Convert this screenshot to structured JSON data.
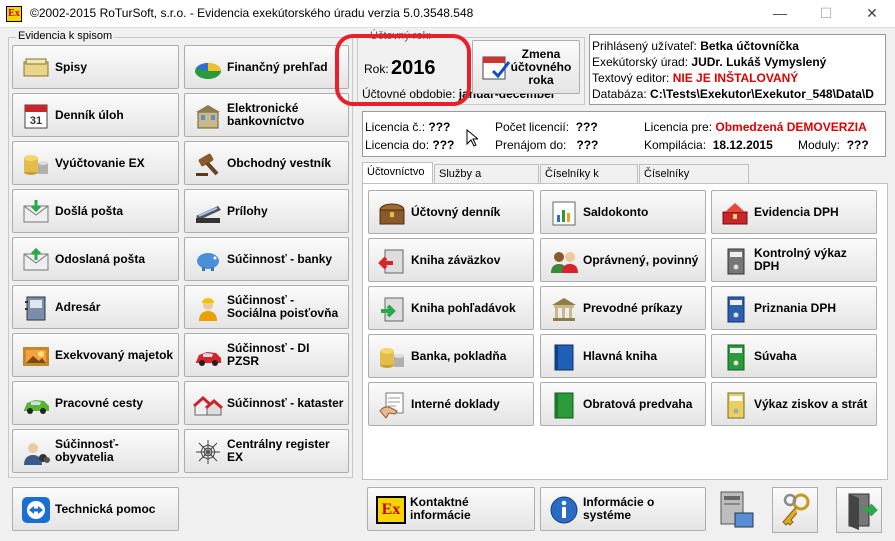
{
  "window": {
    "title": "©2002-2015 RoTurSoft, s.r.o. - Evidencia exekútorského úradu verzia 5.0.3548.548",
    "app_icon": "Ex"
  },
  "left_group": {
    "label": "Evidencia k spisom",
    "buttons": [
      {
        "label": "Spisy",
        "icon": "folder-stack-icon"
      },
      {
        "label": "Finančný prehľad",
        "icon": "pie-chart-icon"
      },
      {
        "label": "Denník úloh",
        "icon": "calendar-icon"
      },
      {
        "label": "Elektronické bankovníctvo",
        "icon": "bank-building-icon"
      },
      {
        "label": "Vyúčtovanie EX",
        "icon": "coins-icon"
      },
      {
        "label": "Obchodný vestník",
        "icon": "gavel-icon"
      },
      {
        "label": "Došlá pošta",
        "icon": "incoming-mail-icon"
      },
      {
        "label": "Prílohy",
        "icon": "scanner-icon"
      },
      {
        "label": "Odoslaná pošta",
        "icon": "outgoing-mail-icon"
      },
      {
        "label": "Súčinnosť - banky",
        "icon": "piggy-bank-icon"
      },
      {
        "label": "Adresár",
        "icon": "address-book-icon"
      },
      {
        "label": "Súčinnosť - Sociálna poisťovňa",
        "icon": "worker-icon"
      },
      {
        "label": "Exekvovaný majetok",
        "icon": "painting-icon"
      },
      {
        "label": "Súčinnosť - DI PZSR",
        "icon": "red-car-icon"
      },
      {
        "label": "Pracovné cesty",
        "icon": "green-car-icon"
      },
      {
        "label": "Súčinnosť - kataster",
        "icon": "houses-icon"
      },
      {
        "label": "Súčinnosť- obyvatelia",
        "icon": "people-icon"
      },
      {
        "label": "Centrálny register EX",
        "icon": "spider-web-icon"
      }
    ]
  },
  "year": {
    "group_label": "Účtovný rok:",
    "label": "Rok:",
    "value": "2016",
    "period_label": "Účtovné obdobie:",
    "period_value": "január-december",
    "change_button": "Zmena účtovného roka"
  },
  "user_info": [
    {
      "label": "Prihlásený užívateľ:",
      "value": "Betka účtovníčka",
      "red": false
    },
    {
      "label": "Exekútorský úrad:",
      "value": "JUDr. Lukáš Vymyslený",
      "red": false
    },
    {
      "label": "Textový editor:",
      "value": "NIE JE INŠTALOVANÝ",
      "red": true
    },
    {
      "label": "Databáza:",
      "value": "C:\\Tests\\Exekutor\\Exekutor_548\\Data\\D",
      "red": false
    }
  ],
  "license": {
    "number_label": "Licencia č.:",
    "number_value": "???",
    "count_label": "Počet licencií:",
    "count_value": "???",
    "for_label": "Licencia pre:",
    "for_value": "Obmedzená DEMOVERZIA",
    "until_label": "Licencia do:",
    "until_value": "???",
    "login_label": "Prenájom do:",
    "login_value": "???",
    "compile_label": "Kompilácia:",
    "compile_value": "18.12.2015",
    "modules_label": "Moduly:",
    "modules_value": "???"
  },
  "tabs": [
    "Účtovníctvo",
    "Služby a nastavenia",
    "Číselníky k spisom",
    "Číselníky účtovníctva"
  ],
  "acc_buttons": [
    {
      "label": "Účtovný denník",
      "icon": "treasure-chest-icon"
    },
    {
      "label": "Saldokonto",
      "icon": "chart-report-icon"
    },
    {
      "label": "Evidencia DPH",
      "icon": "tax-chest-icon"
    },
    {
      "label": "Kniha záväzkov",
      "icon": "red-arrow-book-icon"
    },
    {
      "label": "Oprávnený, povinný",
      "icon": "two-persons-icon"
    },
    {
      "label": "Kontrolný výkaz DPH",
      "icon": "gray-binder-icon"
    },
    {
      "label": "Kniha pohľadávok",
      "icon": "green-arrow-book-icon"
    },
    {
      "label": "Prevodné príkazy",
      "icon": "bank-icon"
    },
    {
      "label": "Priznania DPH",
      "icon": "blue-binder-icon"
    },
    {
      "label": "Banka, pokladňa",
      "icon": "coins-icon"
    },
    {
      "label": "Hlavná kniha",
      "icon": "blue-book-icon"
    },
    {
      "label": "Súvaha",
      "icon": "green-binder-icon"
    },
    {
      "label": "Interné doklady",
      "icon": "hand-document-icon"
    },
    {
      "label": "Obratová predvaha",
      "icon": "green-book-icon"
    },
    {
      "label": "Výkaz ziskov a strát",
      "icon": "yellow-binder-icon"
    }
  ],
  "bottom": {
    "help": "Technická pomoc",
    "contacts": "Kontaktné informácie",
    "contacts_icon": "Ex",
    "about": "Informácie o systéme"
  }
}
